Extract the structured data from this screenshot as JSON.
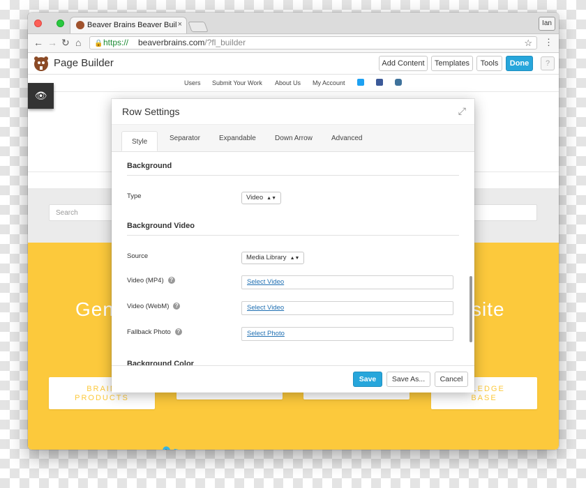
{
  "browser": {
    "tab_title": "Beaver Brains Beaver Builder W",
    "tab_close": "×",
    "profile": "Ian",
    "url_scheme": "https://",
    "url_host": "beaverbrains.com",
    "url_path": "/?fl_builder",
    "nav_icons": [
      "back-arrow-icon",
      "forward-arrow-icon",
      "reload-icon",
      "home-icon"
    ]
  },
  "builder": {
    "title": "Page Builder",
    "buttons": [
      "Add Content",
      "Templates",
      "Tools",
      "Done"
    ],
    "help": "?",
    "accent": "#27a6db"
  },
  "site": {
    "nav": [
      "Users",
      "Submit Your Work",
      "About Us",
      "My Account"
    ],
    "search_placeholder": "Search",
    "hero_left": "Gen",
    "hero_right": "site",
    "cards": [
      [
        "BRAIN",
        "PRODUCTS"
      ],
      [
        "",
        ""
      ],
      [
        "",
        ""
      ],
      [
        "WLEDGE",
        "BASE"
      ]
    ],
    "tweet_text": "",
    "yellow": "#fcc93c"
  },
  "modal": {
    "title": "Row Settings",
    "tabs": [
      "Style",
      "Separator",
      "Expandable",
      "Down Arrow",
      "Advanced"
    ],
    "active_tab": "Style",
    "sections": {
      "background": "Background",
      "background_video": "Background Video",
      "background_color": "Background Color"
    },
    "fields": {
      "type_label": "Type",
      "type_value": "Video",
      "source_label": "Source",
      "source_value": "Media Library",
      "mp4_label": "Video (MP4)",
      "mp4_action": "Select Video",
      "webm_label": "Video (WebM)",
      "webm_action": "Select Video",
      "fallback_label": "Fallback Photo",
      "fallback_action": "Select Photo"
    },
    "footer": {
      "save": "Save",
      "save_as": "Save As...",
      "cancel": "Cancel"
    }
  }
}
